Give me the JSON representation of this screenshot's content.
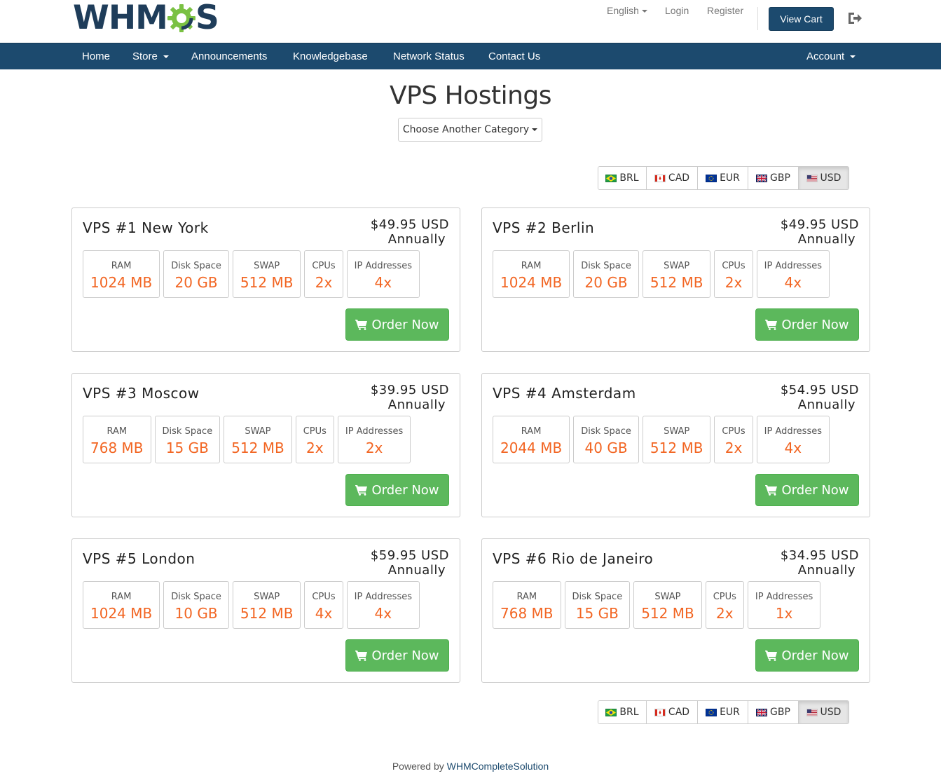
{
  "brand": {
    "logo_text_left": "WHM",
    "logo_text_right": "S"
  },
  "header": {
    "language": "English",
    "login": "Login",
    "register": "Register",
    "view_cart": "View Cart"
  },
  "nav": {
    "home": "Home",
    "store": "Store",
    "announcements": "Announcements",
    "knowledgebase": "Knowledgebase",
    "network_status": "Network Status",
    "contact_us": "Contact Us",
    "account": "Account"
  },
  "page": {
    "title": "VPS Hostings",
    "category_button": "Choose Another Category"
  },
  "currencies": [
    "BRL",
    "CAD",
    "EUR",
    "GBP",
    "USD"
  ],
  "active_currency": "USD",
  "spec_labels": {
    "ram": "RAM",
    "disk": "Disk Space",
    "swap": "SWAP",
    "cpus": "CPUs",
    "ip": "IP Addresses"
  },
  "order_label": "Order Now",
  "products": [
    {
      "name": "VPS #1 New York",
      "price": "$49.95 USD",
      "cycle": "Annually",
      "ram": "1024 MB",
      "disk": "20 GB",
      "swap": "512 MB",
      "cpus": "2x",
      "ip": "4x"
    },
    {
      "name": "VPS #2 Berlin",
      "price": "$49.95 USD",
      "cycle": "Annually",
      "ram": "1024 MB",
      "disk": "20 GB",
      "swap": "512 MB",
      "cpus": "2x",
      "ip": "4x"
    },
    {
      "name": "VPS #3 Moscow",
      "price": "$39.95 USD",
      "cycle": "Annually",
      "ram": "768 MB",
      "disk": "15 GB",
      "swap": "512 MB",
      "cpus": "2x",
      "ip": "2x"
    },
    {
      "name": "VPS #4 Amsterdam",
      "price": "$54.95 USD",
      "cycle": "Annually",
      "ram": "2044 MB",
      "disk": "40 GB",
      "swap": "512 MB",
      "cpus": "2x",
      "ip": "4x"
    },
    {
      "name": "VPS #5 London",
      "price": "$59.95 USD",
      "cycle": "Annually",
      "ram": "1024 MB",
      "disk": "10 GB",
      "swap": "512 MB",
      "cpus": "4x",
      "ip": "4x"
    },
    {
      "name": "VPS #6 Rio de Janeiro",
      "price": "$34.95 USD",
      "cycle": "Annually",
      "ram": "768 MB",
      "disk": "15 GB",
      "swap": "512 MB",
      "cpus": "2x",
      "ip": "1x"
    }
  ],
  "footer": {
    "prefix": "Powered by",
    "link": "WHMCompleteSolution"
  },
  "colors": {
    "brand_navy": "#1c4a6e",
    "accent_orange": "#f26522",
    "order_green": "#5cb85c",
    "gear_green": "#7ac143"
  }
}
